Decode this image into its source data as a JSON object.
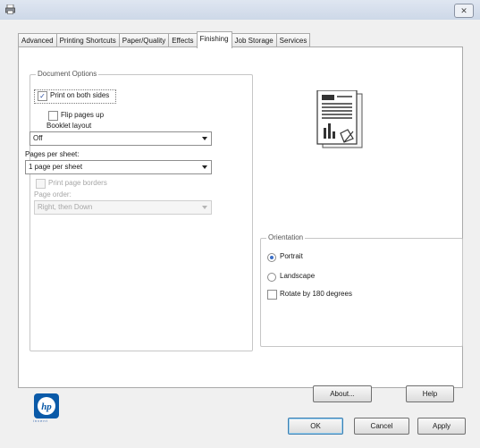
{
  "window": {
    "close_label": "✕"
  },
  "tabs": [
    {
      "label": "Advanced",
      "active": false
    },
    {
      "label": "Printing Shortcuts",
      "active": false
    },
    {
      "label": "Paper/Quality",
      "active": false
    },
    {
      "label": "Effects",
      "active": false
    },
    {
      "label": "Finishing",
      "active": true
    },
    {
      "label": "Job Storage",
      "active": false
    },
    {
      "label": "Services",
      "active": false
    }
  ],
  "document_options": {
    "legend": "Document Options",
    "print_both_sides": {
      "label": "Print on both sides",
      "checked": true
    },
    "flip_pages_up": {
      "label": "Flip pages up",
      "checked": false
    },
    "booklet_layout": {
      "label": "Booklet layout",
      "value": "Off"
    },
    "pages_per_sheet": {
      "label": "Pages per sheet:",
      "value": "1 page per sheet"
    },
    "print_page_borders": {
      "label": "Print page borders",
      "checked": false,
      "enabled": false
    },
    "page_order": {
      "label": "Page order:",
      "value": "Right, then Down",
      "enabled": false
    }
  },
  "orientation": {
    "legend": "Orientation",
    "options": [
      {
        "label": "Portrait",
        "selected": true
      },
      {
        "label": "Landscape",
        "selected": false
      }
    ],
    "rotate": {
      "label": "Rotate by 180 degrees",
      "checked": false
    }
  },
  "buttons": {
    "about": "About...",
    "help": "Help",
    "ok": "OK",
    "cancel": "Cancel",
    "apply": "Apply"
  },
  "logo": {
    "text": "hp",
    "tagline": "invent"
  },
  "colors": {
    "titlebar": "#cdd8e8",
    "accent": "#3c6fc7",
    "hp_blue": "#0a5aa8"
  }
}
